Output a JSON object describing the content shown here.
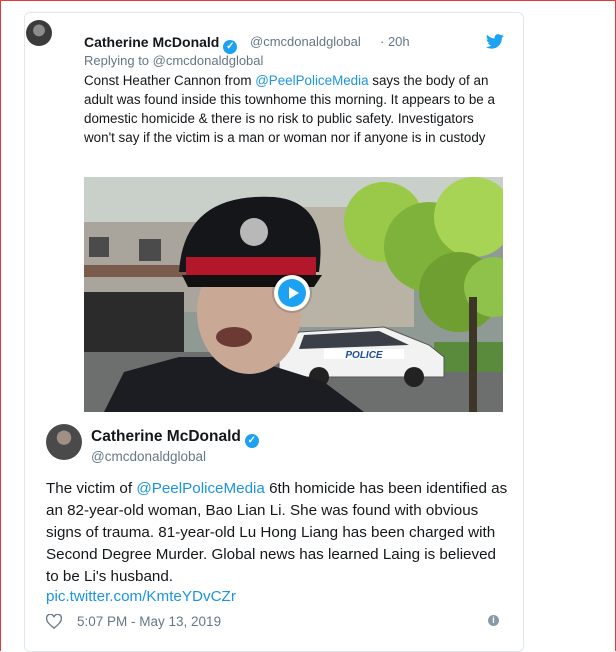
{
  "quoted_tweet": {
    "author_name": "Catherine McDonald",
    "handle": "@cmcdonaldglobal",
    "time": "· 20h",
    "replying_to": "Replying to @cmcdonaldglobal",
    "text_before_link": "Const Heather Cannon from ",
    "link": "@PeelPoliceMedia",
    "text_after_link": " says the body of an adult was found inside this townhome this morning. It appears to be a domestic homicide & there is no risk to public safety. Investigators won't say if the victim is a man or woman nor if anyone is in custody",
    "media": {
      "car_label": "POLICE"
    }
  },
  "main_tweet": {
    "author_name": "Catherine McDonald",
    "handle": "@cmcdonaldglobal",
    "text_before_link": "The victim of ",
    "link": "@PeelPoliceMedia",
    "text_after_link": " 6th homicide has been identified as an 82-year-old woman, Bao Lian Li. She was found with obvious signs of trauma. 81-year-old Lu Hong Liang has been charged with Second Degree Murder. Global news has learned Laing is believed to be Li's husband.",
    "pic_link": "pic.twitter.com/KmteYDvCZr",
    "timestamp": "5:07 PM - May 13, 2019"
  },
  "icons": [
    "verified-icon",
    "twitter-bird-icon",
    "play-icon",
    "heart-icon",
    "info-icon"
  ],
  "colors": {
    "accent": "#1da1f2",
    "link": "#1b95e0",
    "muted": "#657786"
  }
}
